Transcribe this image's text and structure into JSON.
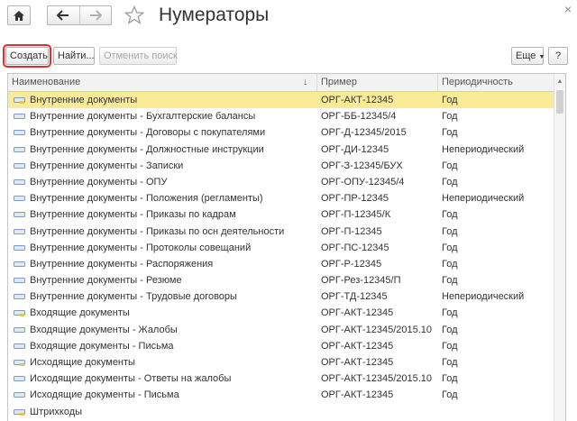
{
  "window": {
    "title": "Нумераторы"
  },
  "toolbar": {
    "create_label": "Создать",
    "find_label": "Найти...",
    "cancel_search_label": "Отменить поиск",
    "more_label": "Еще",
    "help_label": "?"
  },
  "table": {
    "columns": {
      "name": "Наименование",
      "example": "Пример",
      "period": "Периодичность"
    },
    "rows": [
      {
        "name": "Внутренние документы",
        "example": "ОРГ-АКТ-12345",
        "period": "Год"
      },
      {
        "name": "Внутренние документы - Бухгалтерские балансы",
        "example": "ОРГ-ББ-12345/4",
        "period": "Год"
      },
      {
        "name": "Внутренние документы - Договоры с покупателями",
        "example": "ОРГ-Д-12345/2015",
        "period": "Год"
      },
      {
        "name": "Внутренние документы - Должностные инструкции",
        "example": "ОРГ-ДИ-12345",
        "period": "Непериодический"
      },
      {
        "name": "Внутренние документы - Записки",
        "example": "ОРГ-З-12345/БУХ",
        "period": "Год"
      },
      {
        "name": "Внутренние документы - ОПУ",
        "example": "ОРГ-ОПУ-12345/4",
        "period": "Год"
      },
      {
        "name": "Внутренние документы - Положения (регламенты)",
        "example": "ОРГ-ПР-12345",
        "period": "Непериодический"
      },
      {
        "name": "Внутренние документы - Приказы по кадрам",
        "example": "ОРГ-П-12345/К",
        "period": "Год"
      },
      {
        "name": "Внутренние документы - Приказы по осн деятельности",
        "example": "ОРГ-П-12345",
        "period": "Год"
      },
      {
        "name": "Внутренние документы - Протоколы совещаний",
        "example": "ОРГ-ПС-12345",
        "period": "Год"
      },
      {
        "name": "Внутренние документы - Распоряжения",
        "example": "ОРГ-Р-12345",
        "period": "Год"
      },
      {
        "name": "Внутренние документы - Резюме",
        "example": "ОРГ-Рез-12345/П",
        "period": "Год"
      },
      {
        "name": "Внутренние документы - Трудовые договоры",
        "example": "ОРГ-ТД-12345",
        "period": "Непериодический"
      },
      {
        "name": "Входящие документы",
        "example": "ОРГ-АКТ-12345",
        "period": "Год"
      },
      {
        "name": "Входящие документы - Жалобы",
        "example": "ОРГ-АКТ-12345/2015.10",
        "period": "Год"
      },
      {
        "name": "Входящие документы - Письма",
        "example": "ОРГ-АКТ-12345",
        "period": "Год"
      },
      {
        "name": "Исходящие документы",
        "example": "ОРГ-АКТ-12345",
        "period": "Год"
      },
      {
        "name": "Исходящие документы - Ответы на жалобы",
        "example": "ОРГ-АКТ-12345/2015.10",
        "period": "Год"
      },
      {
        "name": "Исходящие документы - Письма",
        "example": "ОРГ-АКТ-12345",
        "period": "Год"
      },
      {
        "name": "Штрихкоды",
        "example": "",
        "period": ""
      }
    ]
  },
  "colors": {
    "selected_row": "#fbeb98",
    "highlight_outline": "#e03030",
    "row_icon": "#7a9cc6"
  }
}
